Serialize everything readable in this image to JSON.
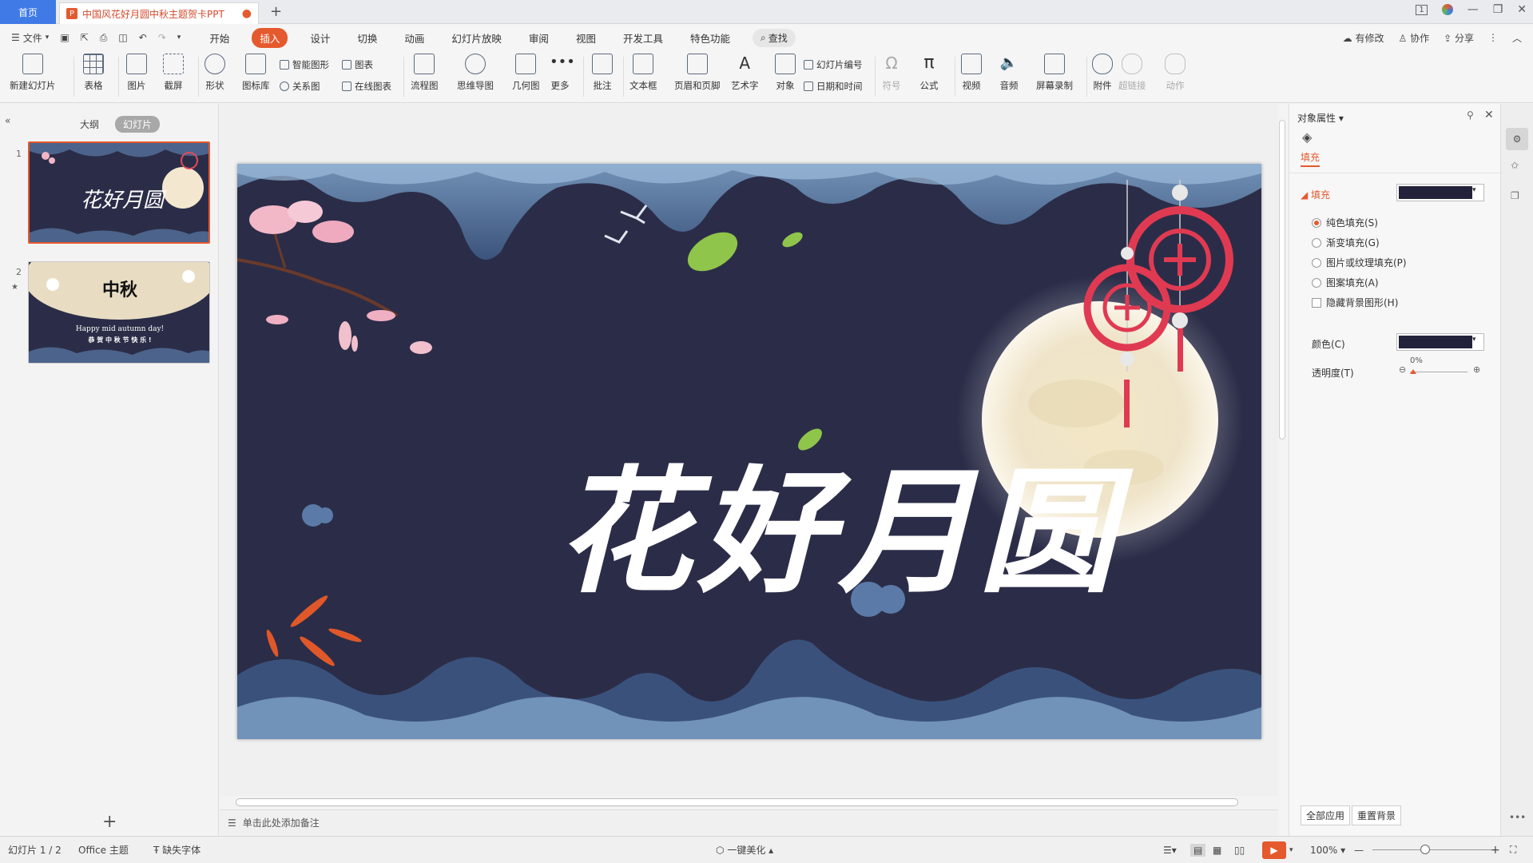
{
  "titlebar": {
    "home_tab": "首页",
    "doc_tab": "中国风花好月圆中秋主题贺卡PPT",
    "ppt_badge": "P",
    "modified_dot": "●",
    "add_tab": "+",
    "window_buttons": [
      "1",
      "—",
      "❐",
      "✕"
    ]
  },
  "menubar": {
    "file": "文件",
    "tabs": [
      "开始",
      "插入",
      "设计",
      "切换",
      "动画",
      "幻灯片放映",
      "审阅",
      "视图",
      "开发工具",
      "特色功能"
    ],
    "active_tab": "插入",
    "search": "查找",
    "right": {
      "modified": "有修改",
      "collab": "协作",
      "share": "分享"
    }
  },
  "ribbon": {
    "new_slide": "新建幻灯片",
    "table": "表格",
    "picture": "图片",
    "screenshot": "截屏",
    "shape": "形状",
    "icons": "图标库",
    "smart_art": "智能图形",
    "chart": "图表",
    "relation": "关系图",
    "online_chart": "在线图表",
    "flowchart": "流程图",
    "mindmap": "思维导图",
    "geometry": "几何图",
    "more": "更多",
    "comment": "批注",
    "textbox": "文本框",
    "header_footer": "页眉和页脚",
    "wordart": "艺术字",
    "object": "对象",
    "slide_number": "幻灯片编号",
    "datetime": "日期和时间",
    "symbol": "符号",
    "formula": "公式",
    "video": "视频",
    "audio": "音频",
    "screen_record": "屏幕录制",
    "attachment": "附件",
    "hyperlink": "超链接",
    "action": "动作"
  },
  "leftpanel": {
    "tab_outline": "大纲",
    "tab_slides": "幻灯片",
    "slides": [
      {
        "num": "1",
        "title": "花好月圆"
      },
      {
        "num": "2",
        "title": "中秋",
        "line1": "Happy mid autumn day!",
        "line2": "恭 贺 中 秋 节 快 乐 !"
      }
    ],
    "add": "+"
  },
  "slide": {
    "title": "花好月圆"
  },
  "notes": {
    "placeholder": "单击此处添加备注"
  },
  "rightpanel": {
    "title": "对象属性",
    "tab_fill": "填充",
    "section_fill": "填充",
    "options": [
      "纯色填充(S)",
      "渐变填充(G)",
      "图片或纹理填充(P)",
      "图案填充(A)"
    ],
    "hide_bg": "隐藏背景图形(H)",
    "color_label": "颜色(C)",
    "transparency_label": "透明度(T)",
    "transparency_value": "0%",
    "apply_all": "全部应用",
    "reset_bg": "重置背景",
    "fill_color": "#22233a"
  },
  "statusbar": {
    "slide_pos": "幻灯片 1 / 2",
    "theme": "Office 主题",
    "missing_font": "缺失字体",
    "beautify": "一键美化",
    "zoom": "100%"
  },
  "colors": {
    "accent": "#e5592e",
    "blue": "#3f7ae6",
    "slide_bg": "#2b2d48"
  }
}
